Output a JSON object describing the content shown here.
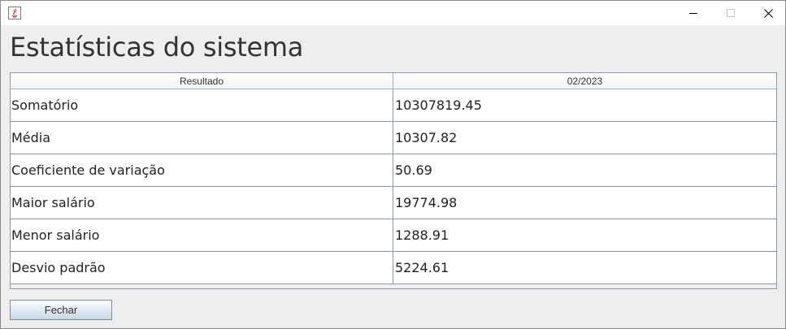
{
  "window": {
    "icon": "java-icon",
    "controls": [
      "minimize-icon",
      "maximize-icon",
      "close-icon"
    ]
  },
  "heading": "Estatísticas do sistema",
  "table": {
    "columns": [
      "Resultado",
      "02/2023"
    ],
    "rows": [
      [
        "Somatório",
        "10307819.45"
      ],
      [
        "Média",
        "10307.82"
      ],
      [
        "Coeficiente de variação",
        "50.69"
      ],
      [
        "Maior salário",
        "19774.98"
      ],
      [
        "Menor salário",
        "1288.91"
      ],
      [
        "Desvio padrão",
        "5224.61"
      ]
    ]
  },
  "footer": {
    "close_label": "Fechar"
  }
}
